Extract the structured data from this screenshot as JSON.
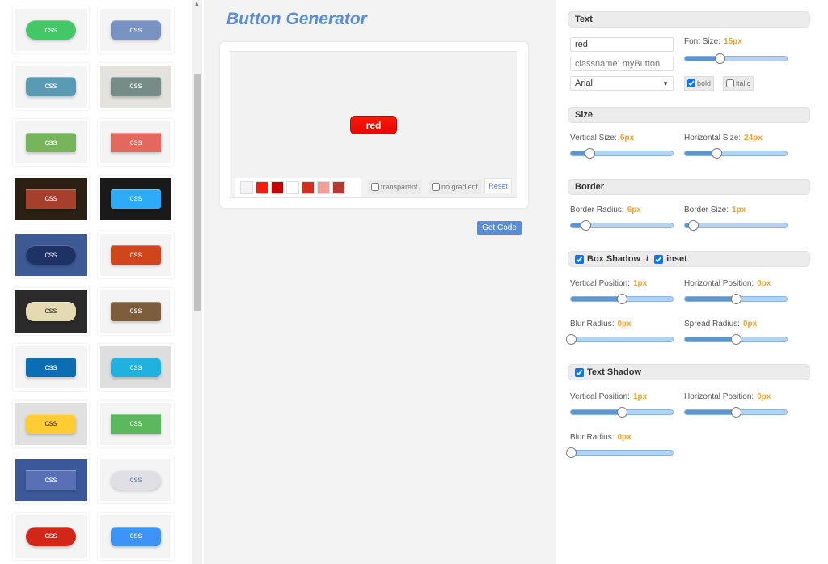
{
  "gallery": {
    "label": "css",
    "tiles": [
      {
        "bg": "#f4f4f4",
        "btn": "#44c767",
        "fg": "#fff",
        "r": "14px"
      },
      {
        "bg": "#f4f4f4",
        "btn": "#7892c2",
        "fg": "#fff",
        "r": "6px"
      },
      {
        "bg": "#f4f4f4",
        "btn": "#599bb3",
        "fg": "#fff",
        "r": "6px"
      },
      {
        "bg": "#e4e2dc",
        "btn": "#768d87",
        "fg": "#fff",
        "r": "3px"
      },
      {
        "bg": "#f4f4f4",
        "btn": "#77b55a",
        "fg": "#fff",
        "r": "3px"
      },
      {
        "bg": "#f4f4f4",
        "btn": "#e4685d",
        "fg": "#fff",
        "r": "0"
      },
      {
        "bg": "#2c1f14",
        "btn": "#a73f2d",
        "fg": "#fff",
        "r": "0"
      },
      {
        "bg": "#1a1a1a",
        "btn": "#2dabf9",
        "fg": "#fff",
        "r": "3px"
      },
      {
        "bg": "#3d5a95",
        "btn": "#1e3266",
        "fg": "#ddd",
        "r": "14px"
      },
      {
        "bg": "#f4f4f4",
        "btn": "#d0451b",
        "fg": "#fff",
        "r": "3px"
      },
      {
        "bg": "#2b2b2b",
        "btn": "#e5dbb2",
        "fg": "#333",
        "r": "10px"
      },
      {
        "bg": "#f4f4f4",
        "btn": "#7d5d3b",
        "fg": "#fff",
        "r": "3px"
      },
      {
        "bg": "#f4f4f4",
        "btn": "#0b6eb4",
        "fg": "#fff",
        "r": "3px"
      },
      {
        "bg": "#dedede",
        "btn": "#1fb1e0",
        "fg": "#fff",
        "r": "6px"
      },
      {
        "bg": "#e0e0e0",
        "btn": "#ffcc33",
        "fg": "#333",
        "r": "6px"
      },
      {
        "bg": "#f4f4f4",
        "btn": "#5cb85c",
        "fg": "#fff",
        "r": "0"
      },
      {
        "bg": "#3b5998",
        "btn": "#5970b5",
        "fg": "#fff",
        "r": "0"
      },
      {
        "bg": "#f4f4f4",
        "btn": "#e0dfe5",
        "fg": "#5a7fb8",
        "r": "14px"
      },
      {
        "bg": "#f4f4f4",
        "btn": "#d02718",
        "fg": "#fff",
        "r": "14px"
      },
      {
        "bg": "#f4f4f4",
        "btn": "#3d94f6",
        "fg": "#fff",
        "r": "6px"
      }
    ]
  },
  "main": {
    "title": "Button Generator",
    "preview_label": "red",
    "swatches": [
      "#f4f4f4",
      "#f81a0a",
      "#c50000",
      "#ffffff",
      "#d42d22",
      "#f0a09a",
      "#b53a33"
    ],
    "transparent": "transparent",
    "no_gradient": "no gradient",
    "reset": "Reset",
    "get_code": "Get Code"
  },
  "panel": {
    "text_title": "Text",
    "text_value": "red",
    "class_placeholder": "classname: myButton",
    "font": "Arial",
    "font_size_label": "Font Size:",
    "font_size": "15px",
    "font_size_pct": 34,
    "bold": "bold",
    "italic": "italic",
    "size_title": "Size",
    "vsize_label": "Vertical Size:",
    "vsize": "6px",
    "vsize_pct": 18,
    "hsize_label": "Horizontal Size:",
    "hsize": "24px",
    "hsize_pct": 31,
    "border_title": "Border",
    "bradius_label": "Border Radius:",
    "bradius": "6px",
    "bradius_pct": 14,
    "bsize_label": "Border Size:",
    "bsize": "1px",
    "bsize_pct": 8,
    "box_shadow_title": "Box Shadow",
    "slash": "/",
    "inset": "inset",
    "bs_vpos_label": "Vertical Position:",
    "bs_vpos": "1px",
    "bs_vpos_pct": 50,
    "bs_hpos_label": "Horizontal Position:",
    "bs_hpos": "0px",
    "bs_hpos_pct": 50,
    "bs_blur_label": "Blur Radius:",
    "bs_blur": "0px",
    "bs_blur_pct": 0,
    "bs_spread_label": "Spread Radius:",
    "bs_spread": "0px",
    "bs_spread_pct": 50,
    "text_shadow_title": "Text Shadow",
    "ts_vpos_label": "Vertical Position:",
    "ts_vpos": "1px",
    "ts_vpos_pct": 50,
    "ts_hpos_label": "Horizontal Position:",
    "ts_hpos": "0px",
    "ts_hpos_pct": 50,
    "ts_blur_label": "Blur Radius:",
    "ts_blur": "0px",
    "ts_blur_pct": 0
  }
}
